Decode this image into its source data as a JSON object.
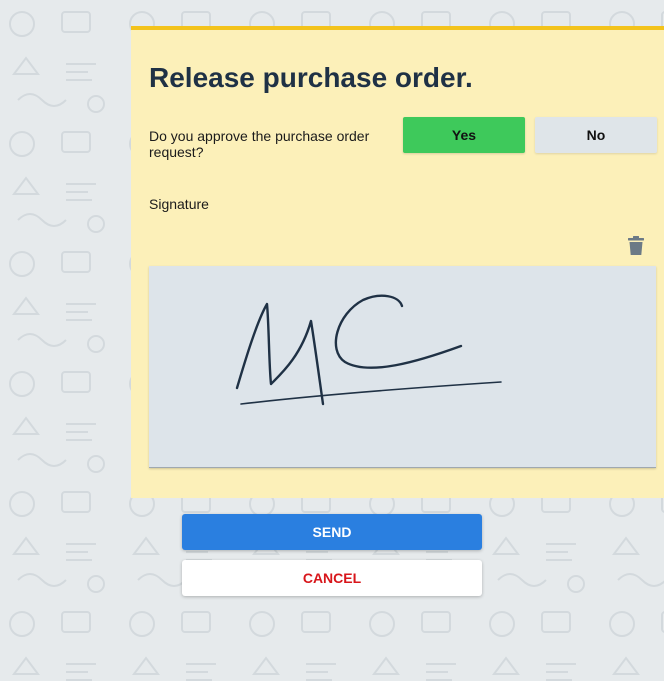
{
  "form": {
    "title": "Release purchase order.",
    "question": "Do you approve the purchase order request?",
    "yes_label": "Yes",
    "no_label": "No",
    "signature_label": "Signature",
    "signature_initials": "MC"
  },
  "actions": {
    "send_label": "SEND",
    "cancel_label": "CANCEL"
  },
  "icons": {
    "delete": "trash-icon",
    "background": "doodle-pattern"
  },
  "colors": {
    "card_bg": "#fcf0b9",
    "card_accent": "#f3c31c",
    "yes_button": "#3ec95b",
    "no_button": "#dfe5e9",
    "send_button": "#2a7fe0",
    "cancel_text": "#d8161b",
    "signature_ink": "#1f3145"
  }
}
